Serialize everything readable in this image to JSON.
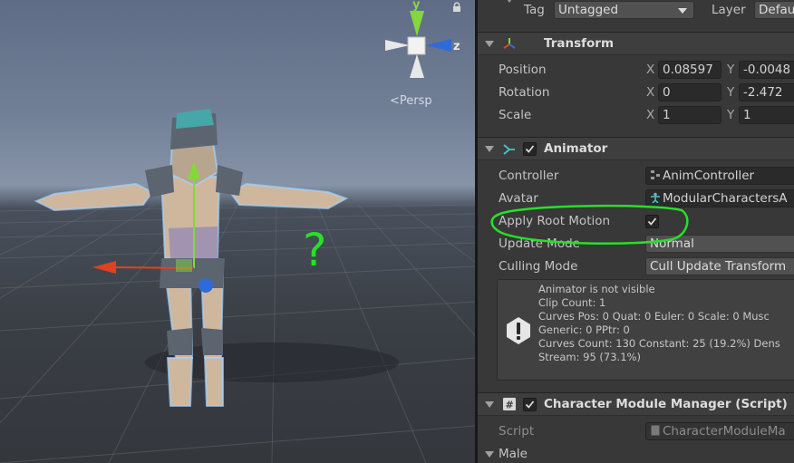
{
  "scene": {
    "gizmo": {
      "y_label": "y",
      "z_label": "z"
    },
    "projection_label": "Persp",
    "annotation_mark": "?"
  },
  "inspector": {
    "tag": {
      "label": "Tag",
      "value": "Untagged"
    },
    "layer": {
      "label": "Layer",
      "value": "Defau"
    },
    "transform": {
      "title": "Transform",
      "position": {
        "label": "Position",
        "x_label": "X",
        "x": "0.08597",
        "y_label": "Y",
        "y": "-0.0048"
      },
      "rotation": {
        "label": "Rotation",
        "x_label": "X",
        "x": "0",
        "y_label": "Y",
        "y": "-2.472"
      },
      "scale": {
        "label": "Scale",
        "x_label": "X",
        "x": "1",
        "y_label": "Y",
        "y": "1"
      }
    },
    "animator": {
      "title": "Animator",
      "enabled": true,
      "controller": {
        "label": "Controller",
        "value": "AnimController"
      },
      "avatar": {
        "label": "Avatar",
        "value": "ModularCharactersA"
      },
      "apply_root_motion": {
        "label": "Apply Root Motion",
        "checked": true
      },
      "update_mode": {
        "label": "Update Mode",
        "value": "Normal"
      },
      "culling_mode": {
        "label": "Culling Mode",
        "value": "Cull Update Transform"
      },
      "info_lines": [
        "Animator is not visible",
        "Clip Count: 1",
        "Curves Pos: 0 Quat: 0 Euler: 0 Scale: 0 Musc",
        "Generic: 0 PPtr: 0",
        "Curves Count: 130 Constant: 25 (19.2%) Dens",
        "Stream: 95 (73.1%)"
      ]
    },
    "character_module": {
      "title": "Character Module Manager (Script)",
      "enabled": true,
      "script": {
        "label": "Script",
        "value": "CharacterModuleMa"
      },
      "male_foldout": {
        "label": "Male"
      }
    }
  },
  "colors": {
    "inspector_bg": "#383838",
    "field_bg": "#2a2a2a",
    "annotation_green": "#27e027",
    "gizmo_y": "#84d83a",
    "gizmo_x": "#e0421f",
    "gizmo_z": "#2f6bd8"
  }
}
